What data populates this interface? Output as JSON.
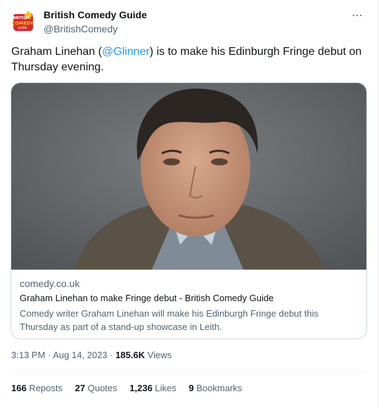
{
  "account": {
    "display_name": "British Comedy Guide",
    "handle": "@BritishComedy",
    "logo_text": [
      "BRITISH",
      "COMEDY",
      "GUIDE"
    ]
  },
  "more_icon": "⋯",
  "tweet": {
    "text_before": "Graham Linehan (",
    "mention": "@Glinner",
    "text_after": ") is to make his Edinburgh Fringe debut on Thursday evening."
  },
  "card": {
    "domain": "comedy.co.uk",
    "title": "Graham Linehan to make Fringe debut - British Comedy Guide",
    "description": "Comedy writer Graham Linehan will make his Edinburgh Fringe debut this Thursday as part of a stand-up showcase in Leith."
  },
  "meta": {
    "time": "3:13 PM",
    "sep1": " · ",
    "date": "Aug 14, 2023",
    "sep2": " · ",
    "views_count": "185.6K",
    "views_label": " Views"
  },
  "stats": [
    {
      "count": "166",
      "label": " Reposts"
    },
    {
      "count": "27",
      "label": " Quotes"
    },
    {
      "count": "1,236",
      "label": " Likes"
    },
    {
      "count": "9",
      "label": " Bookmarks"
    }
  ],
  "colors": {
    "accent": "#1d9bf0",
    "logo_red": "#d8282d",
    "logo_yellow": "#f6c21c"
  }
}
